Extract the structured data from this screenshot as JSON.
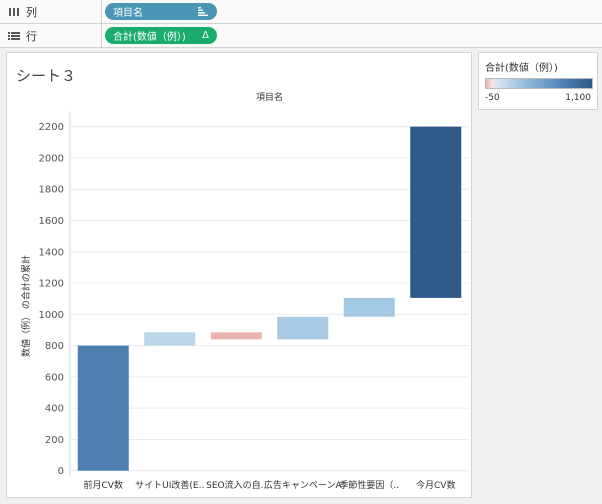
{
  "shelves": {
    "columns": {
      "label": "列",
      "pill": "項目名"
    },
    "rows": {
      "label": "行",
      "pill": "合計(数値（例）)",
      "pill_icon": "Δ"
    }
  },
  "sheet": {
    "title": "シート３"
  },
  "legend": {
    "title": "合計(数値（例）)",
    "min_label": "-50",
    "max_label": "1,100"
  },
  "colors": {
    "dimension_pill": "#4a96b5",
    "measure_pill": "#1bac6b",
    "negative": "#e8b4a8",
    "positive_light": "#a8cbe5",
    "positive_dark": "#2f5987"
  },
  "chart_data": {
    "type": "bar",
    "subtype": "waterfall",
    "title": "",
    "top_axis_label": "項目名",
    "xlabel": "",
    "ylabel": "数値（例） の合計の累計",
    "ylim": [
      -40,
      2300
    ],
    "yticks": [
      0,
      200,
      400,
      600,
      800,
      1000,
      1200,
      1400,
      1600,
      1800,
      2000,
      2200
    ],
    "grid": true,
    "categories": [
      "前月CV数",
      "サイトUI改善(E..",
      "SEO流入の自..",
      "広告キャンペーンA",
      "季節性要因（..",
      "今月CV数"
    ],
    "bars": [
      {
        "start": 0,
        "end": 800,
        "value": 800,
        "color": "#4d7fb0"
      },
      {
        "start": 800,
        "end": 885,
        "value": 85,
        "color": "#bcd6ea"
      },
      {
        "start": 885,
        "end": 840,
        "value": -45,
        "color": "#e9b6ab"
      },
      {
        "start": 840,
        "end": 985,
        "value": 145,
        "color": "#a9cbe4"
      },
      {
        "start": 985,
        "end": 1105,
        "value": 120,
        "color": "#a3c8e3"
      },
      {
        "start": 1105,
        "end": 2200,
        "value": 1095,
        "color": "#2f5987"
      }
    ]
  }
}
